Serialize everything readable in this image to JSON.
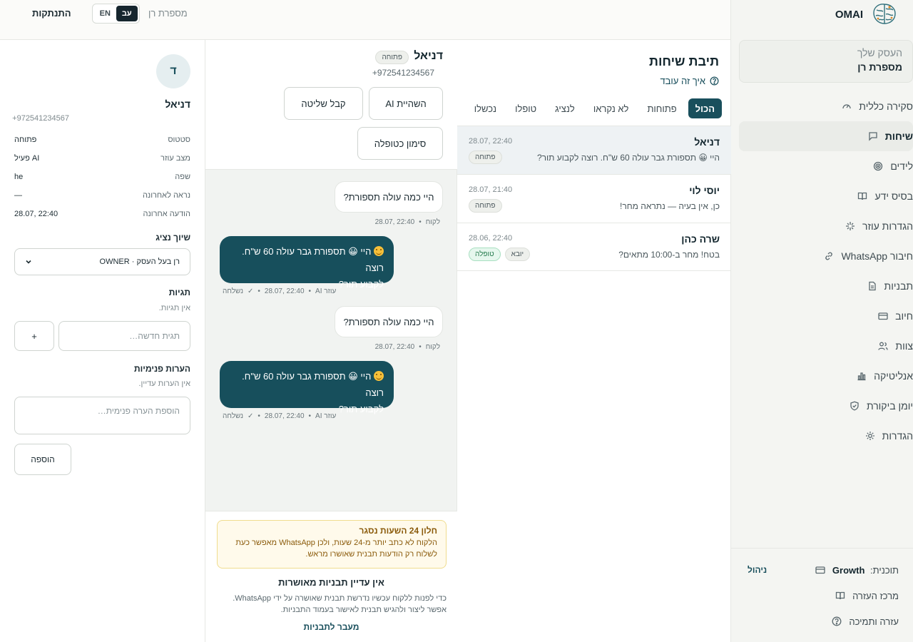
{
  "brand": {
    "name": "OMAI"
  },
  "sidebar": {
    "business_label": "העסק שלך",
    "business_name": "מספרת רן",
    "items": [
      {
        "label": "סקירה כללית",
        "icon": "gauge-icon"
      },
      {
        "label": "שיחות",
        "icon": "chat-icon",
        "active": true
      },
      {
        "label": "לידים",
        "icon": "target-icon"
      },
      {
        "label": "בסיס ידע",
        "icon": "book-icon"
      },
      {
        "label": "הגדרות עוזר",
        "icon": "sparkle-icon"
      },
      {
        "label": "חיבור WhatsApp",
        "icon": "link-icon"
      },
      {
        "label": "תבניות",
        "icon": "document-icon"
      },
      {
        "label": "חיוב",
        "icon": "credit-card-icon"
      },
      {
        "label": "צוות",
        "icon": "users-icon"
      },
      {
        "label": "אנליטיקה",
        "icon": "bar-chart-icon"
      },
      {
        "label": "יומן ביקורת",
        "icon": "shield-icon"
      },
      {
        "label": "הגדרות",
        "icon": "gear-icon"
      }
    ],
    "plan_label": "תוכנית:",
    "plan_name": "Growth",
    "plan_manage": "ניהול",
    "help_center": "מרכז העזרה",
    "support": "עזרה ותמיכה"
  },
  "topbar": {
    "logout": "התנתקות",
    "lang_en": "EN",
    "lang_he": "עב",
    "business_name": "מספרת רן"
  },
  "inbox": {
    "title": "תיבת שיחות",
    "how_it_works": "איך זה עובד",
    "tabs": [
      "הכול",
      "פתוחות",
      "לא נקראו",
      "לנציג",
      "טופלו",
      "נכשלו"
    ],
    "conversations": [
      {
        "name": "דניאל",
        "time": "28.07, 22:40",
        "preview": "היי 😀 תספורת גבר עולה 60 ש\"ח. רוצה לקבוע תור?",
        "badges": [
          "פתוחה"
        ]
      },
      {
        "name": "יוסי לוי",
        "time": "28.07, 21:40",
        "preview": "כן, אין בעיה — נתראה מחר!",
        "badges": [
          "פתוחה"
        ]
      },
      {
        "name": "שרה כהן",
        "time": "28.06, 22:40",
        "preview": "בטח! מחר ב-10:00 מתאים?",
        "badges": [
          "יובא",
          "טופלה"
        ]
      }
    ]
  },
  "chat": {
    "name": "דניאל",
    "status": "פתוחה",
    "phone": "+972541234567",
    "btn_ai_pause": "השהיית AI",
    "btn_takeover": "קבל שליטה",
    "btn_mark_done": "סימון כטופלה",
    "msg_in_1": "היי כמה עולה תספורת?",
    "msg_in_1_meta_who": "לקוח",
    "msg_in_1_meta_time": "28.07, 22:40",
    "msg_out_1_line1": "היי 😀 תספורת גבר עולה 60 ש\"ח. רוצה",
    "msg_out_1_line2": "לקבוע תור?",
    "msg_out_1_meta_who": "עוזר AI",
    "msg_out_1_meta_time": "28.07, 22:40",
    "msg_out_1_meta_status": "נשלחה",
    "msg_in_2": "היי כמה עולה תספורת?",
    "msg_in_2_meta_who": "לקוח",
    "msg_in_2_meta_time": "28.07, 22:40",
    "msg_out_2_line1": "היי 😀 תספורת גבר עולה 60 ש\"ח. רוצה",
    "msg_out_2_line2": "לקבוע תור?",
    "msg_out_2_meta_who": "עוזר AI",
    "msg_out_2_meta_time": "28.07, 22:40",
    "msg_out_2_meta_status": "נשלחה",
    "warn_title": "חלון 24 השעות נסגר",
    "warn_body": "הלקוח לא כתב יותר מ-24 שעות, ולכן WhatsApp מאפשר כעת לשלוח רק הודעות תבנית שאושרו מראש.",
    "no_templates_title": "אין עדיין תבניות מאושרות",
    "no_templates_desc": "כדי לפנות ללקוח עכשיו נדרשת תבנית שאושרה על ידי WhatsApp. אפשר ליצור ולהגיש תבנית לאישור בעמוד התבניות.",
    "go_templates": "מעבר לתבניות"
  },
  "profile": {
    "avatar_letter": "ד",
    "name": "דניאל",
    "phone": "+972541234567",
    "rows": [
      {
        "k": "סטטוס",
        "v": "פתוחה"
      },
      {
        "k": "מצב עוזר",
        "v": "AI פעיל"
      },
      {
        "k": "שפה",
        "v": "he"
      },
      {
        "k": "נראה לאחרונה",
        "v": "—"
      },
      {
        "k": "הודעה אחרונה",
        "v": "28.07, 22:40"
      }
    ],
    "assign_title": "שיוך נציג",
    "assign_value": "רן בעל העסק · OWNER",
    "tags_title": "תגיות",
    "tags_empty": "אין תגיות.",
    "tag_placeholder": "תגית חדשה…",
    "tag_add": "+",
    "notes_title": "הערות פנימיות",
    "notes_empty": "אין הערות עדיין.",
    "note_placeholder": "הוספת הערה פנימית…",
    "note_add": "הוספה"
  }
}
